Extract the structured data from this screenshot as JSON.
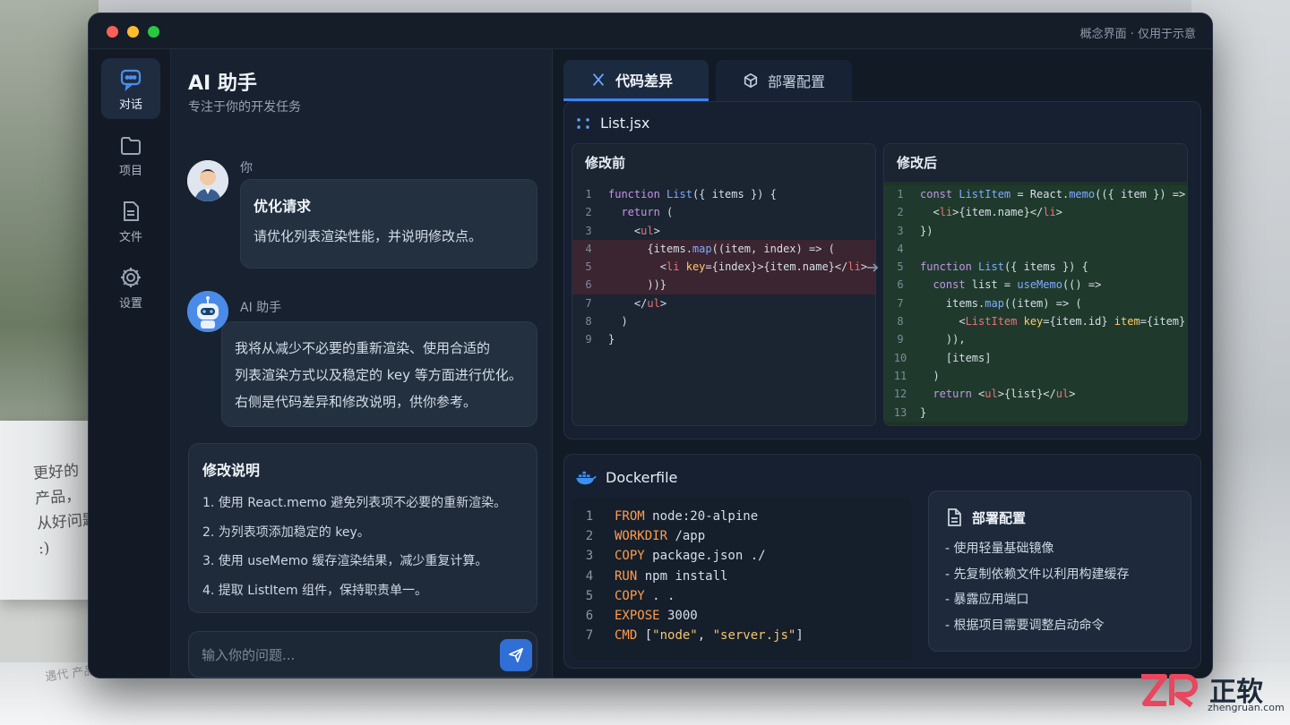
{
  "window": {
    "caption": "概念界面 · 仅用于示意",
    "traffic_lights": [
      "#ff5f57",
      "#febc2e",
      "#28c840"
    ]
  },
  "sidebar": {
    "items": [
      {
        "label": "对话",
        "icon": "chat-bubble-icon",
        "active": true
      },
      {
        "label": "项目",
        "icon": "folder-icon",
        "active": false
      },
      {
        "label": "文件",
        "icon": "document-icon",
        "active": false
      },
      {
        "label": "设置",
        "icon": "gear-icon",
        "active": false
      }
    ]
  },
  "chat": {
    "title": "AI 助手",
    "subtitle": "专注于你的开发任务",
    "user_name": "你",
    "user_bubble_title": "优化请求",
    "user_bubble_text": "请优化列表渲染性能，并说明修改点。",
    "ai_name": "AI 助手",
    "ai_lines": [
      "我将从减少不必要的重新渲染、使用合适的",
      "列表渲染方式以及稳定的 key 等方面进行优化。",
      "右侧是代码差异和修改说明，供你参考。"
    ],
    "notes_title": "修改说明",
    "notes": [
      "1.  使用 React.memo 避免列表项不必要的重新渲染。",
      "2.  为列表项添加稳定的 key。",
      "3.  使用 useMemo 缓存渲染结果，减少重复计算。",
      "4.  提取 ListItem 组件，保持职责单一。"
    ],
    "input_placeholder": "输入你的问题..."
  },
  "tabs": [
    {
      "label": "代码差异",
      "icon": "diff-icon",
      "active": true
    },
    {
      "label": "部署配置",
      "icon": "cube-icon",
      "active": false
    }
  ],
  "diff": {
    "file": "List.jsx",
    "before_label": "修改前",
    "after_label": "修改后",
    "before_lines": [
      "function List({ items }) {",
      "  return (",
      "    <ul>",
      "      {items.map((item, index) => (",
      "        <li key={index}>{item.name}</li>",
      "      ))}",
      "    </ul>",
      "  )",
      "}"
    ],
    "before_removed": [
      4,
      5,
      6
    ],
    "after_lines": [
      "const ListItem = React.memo(({ item }) => (",
      "  <li>{item.name}</li>",
      "})",
      "",
      "function List({ items }) {",
      "  const list = useMemo(() =>",
      "    items.map((item) => (",
      "      <ListItem key={item.id} item={item} />",
      "    )),",
      "    [items]",
      "  )",
      "  return <ul>{list}</ul>",
      "}"
    ],
    "removed_color": "#3a2530",
    "added_color": "#1f3a2c"
  },
  "docker": {
    "file": "Dockerfile",
    "lines": [
      {
        "kw": "FROM",
        "rest": " node:20-alpine"
      },
      {
        "kw": "WORKDIR",
        "rest": " /app"
      },
      {
        "kw": "COPY",
        "rest": " package.json ./"
      },
      {
        "kw": "RUN",
        "rest": " npm install"
      },
      {
        "kw": "COPY",
        "rest": " . ."
      },
      {
        "kw": "EXPOSE",
        "rest": " 3000"
      },
      {
        "kw": "CMD",
        "rest": " [\"node\", \"server.js\"]"
      }
    ],
    "deploy_title": "部署配置",
    "deploy_items": [
      "- 使用轻量基础镜像",
      "- 先复制依赖文件以利用构建缓存",
      "- 暴露应用端口",
      "- 根据项目需要调整启动命令"
    ]
  },
  "background": {
    "mug_text": "更好的\n产品，\n从好问题开始\n:)",
    "paper_text": "遇代 产品素材"
  },
  "watermark": {
    "brand": "正软",
    "url": "zhengruan.com"
  }
}
